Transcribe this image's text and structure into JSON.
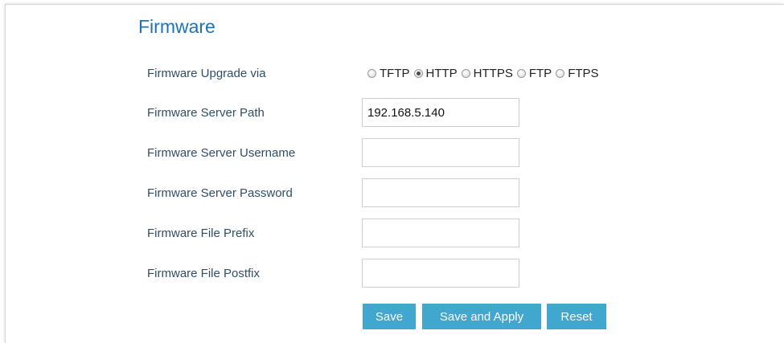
{
  "section": {
    "title": "Firmware"
  },
  "upgrade_via": {
    "label": "Firmware Upgrade via",
    "options": [
      {
        "label": "TFTP",
        "checked": false
      },
      {
        "label": "HTTP",
        "checked": true
      },
      {
        "label": "HTTPS",
        "checked": false
      },
      {
        "label": "FTP",
        "checked": false
      },
      {
        "label": "FTPS",
        "checked": false
      }
    ]
  },
  "fields": {
    "server_path": {
      "label": "Firmware Server Path",
      "value": "192.168.5.140"
    },
    "server_username": {
      "label": "Firmware Server Username",
      "value": ""
    },
    "server_password": {
      "label": "Firmware Server Password",
      "value": ""
    },
    "file_prefix": {
      "label": "Firmware File Prefix",
      "value": ""
    },
    "file_postfix": {
      "label": "Firmware File Postfix",
      "value": ""
    }
  },
  "buttons": {
    "save": "Save",
    "save_apply": "Save and Apply",
    "reset": "Reset"
  },
  "colors": {
    "title": "#1a75b8",
    "label": "#2f4e67",
    "button": "#42a7cf"
  }
}
